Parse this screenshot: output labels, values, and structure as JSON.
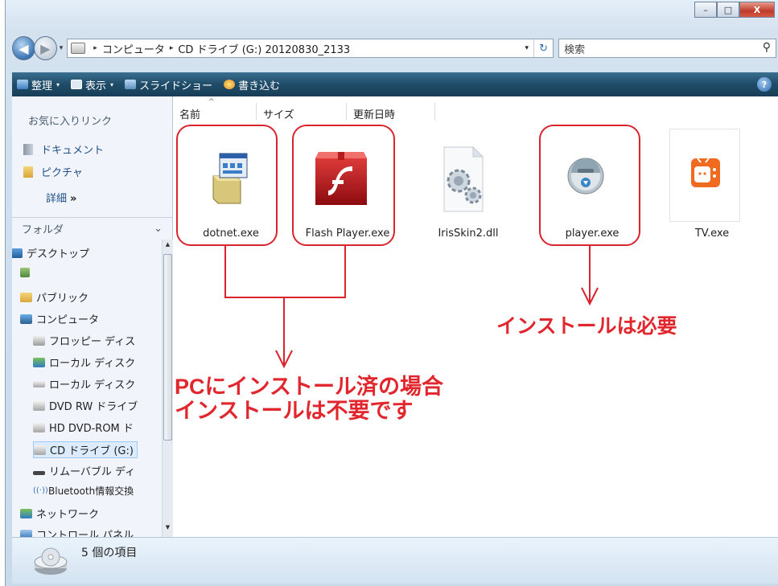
{
  "window": {
    "caption_buttons": {
      "minimize": "–",
      "maximize": "□",
      "close": "X"
    }
  },
  "nav": {
    "back_glyph": "◀",
    "forward_glyph": "▶",
    "history_glyph": "▾"
  },
  "address": {
    "crumbs": [
      "コンピュータ",
      "CD ドライブ (G:) 20120830_2133"
    ],
    "separator": "▸",
    "dropdown_glyph": "▾",
    "refresh_glyph": "↻"
  },
  "search": {
    "placeholder": "検索",
    "icon_glyph": "⚲"
  },
  "toolbar": {
    "organize": "整理",
    "views": "表示",
    "slideshow": "スライドショー",
    "burn": "書き込む",
    "dropdown_glyph": "▾",
    "help_glyph": "?"
  },
  "navpane": {
    "favorites_title": "お気に入りリンク",
    "favorites": [
      "ドキュメント",
      "ピクチャ"
    ],
    "detail_label": "詳細",
    "detail_glyph": "»",
    "folders_title": "フォルダ",
    "folders_toggle": "⌄",
    "tree": [
      "デスクトップ",
      "",
      "パブリック",
      "コンピュータ",
      "フロッピー ディス",
      "ローカル ディスク",
      "ローカル ディスク",
      "DVD RW ドライブ",
      "HD DVD-ROM ド",
      "CD ドライブ (G:)",
      "リムーバブル ディ",
      "Bluetooth情報交換",
      "ネットワーク",
      "コントロール パネル"
    ]
  },
  "columns": {
    "name": "名前",
    "size": "サイズ",
    "modified": "更新日時",
    "sort_glyph": "^"
  },
  "files": [
    {
      "name": "dotnet.exe",
      "icon": "installer-icon"
    },
    {
      "name": "Flash Player.exe",
      "icon": "flash-icon"
    },
    {
      "name": "IrisSkin2.dll",
      "icon": "dll-gears-icon"
    },
    {
      "name": "player.exe",
      "icon": "disc-player-icon"
    },
    {
      "name": "TV.exe",
      "icon": "tv-icon"
    }
  ],
  "annotations": {
    "required": "インストールは必要",
    "not_required_line1": "PCにインストール済の場合",
    "not_required_line2": "インストールは不要です",
    "color": "#e1262d"
  },
  "status": {
    "item_count": "5 個の項目"
  }
}
